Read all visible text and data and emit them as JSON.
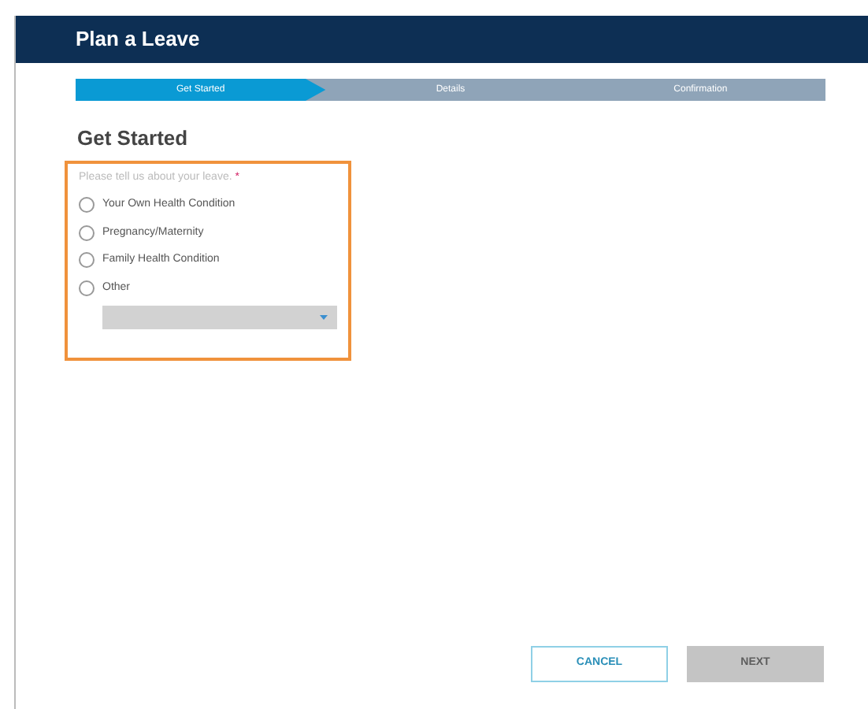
{
  "window": {
    "title": "Plan a Leave"
  },
  "steps": [
    {
      "label": "Get Started",
      "selected": true
    },
    {
      "label": "Details",
      "selected": false
    },
    {
      "label": "Confirmation",
      "selected": false
    }
  ],
  "section_title": "Get Started",
  "question": {
    "label": "Please tell us about your leave.",
    "required_mark": "*"
  },
  "options": [
    {
      "label": "Your Own Health Condition",
      "selected": false
    },
    {
      "label": "Pregnancy/Maternity",
      "selected": false
    },
    {
      "label": "Family Health Condition",
      "selected": false
    },
    {
      "label": "Other",
      "selected": false
    }
  ],
  "other_dropdown": {
    "disabled": true
  },
  "buttons": [
    {
      "label": "CANCEL",
      "kind": "secondary",
      "disabled": false
    },
    {
      "label": "NEXT",
      "kind": "primary",
      "disabled": true
    }
  ]
}
